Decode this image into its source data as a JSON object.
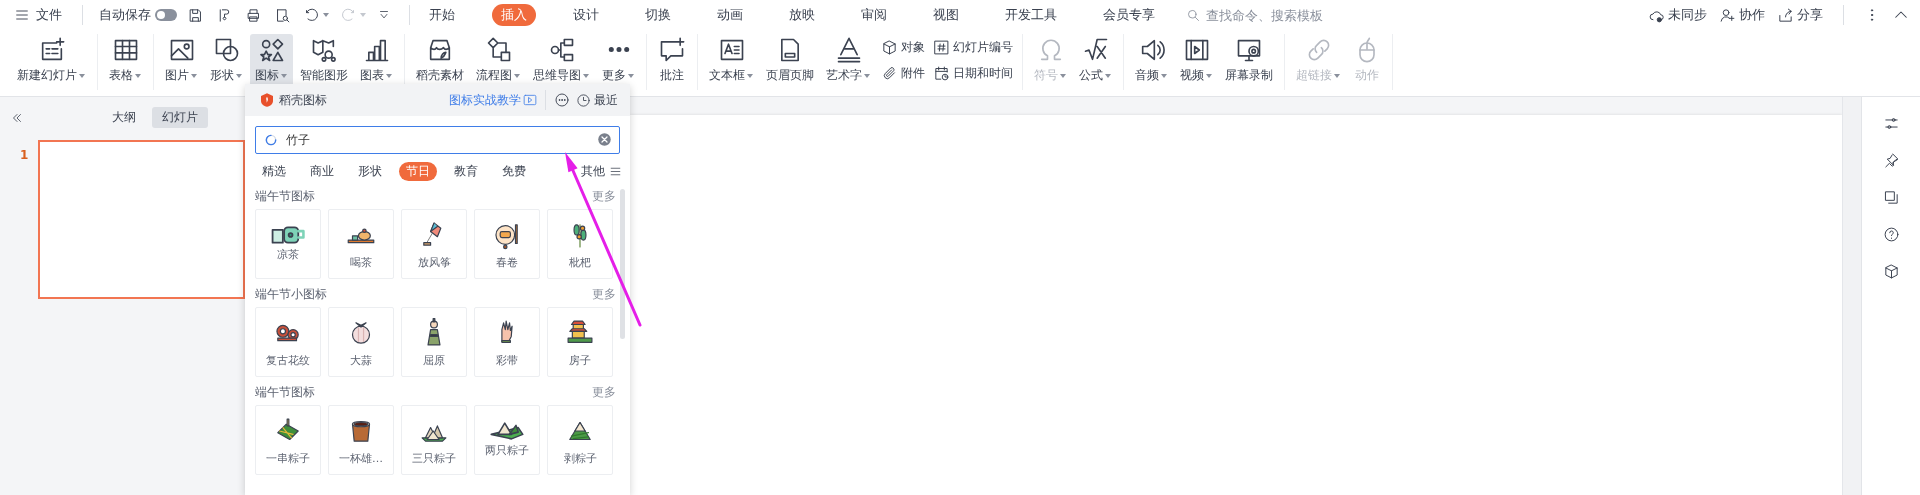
{
  "title_bar": {
    "menu_label": "文件",
    "autosave": {
      "label": "自动保存",
      "on": false
    },
    "tabs": [
      {
        "label": "开始",
        "selected": false
      },
      {
        "label": "插入",
        "selected": true
      },
      {
        "label": "设计",
        "selected": false
      },
      {
        "label": "切换",
        "selected": false
      },
      {
        "label": "动画",
        "selected": false
      },
      {
        "label": "放映",
        "selected": false
      },
      {
        "label": "审阅",
        "selected": false
      },
      {
        "label": "视图",
        "selected": false
      },
      {
        "label": "开发工具",
        "selected": false
      },
      {
        "label": "会员专享",
        "selected": false
      }
    ],
    "search": {
      "placeholder": "查找命令、搜索模板"
    },
    "actions": [
      "未同步",
      "协作",
      "分享"
    ]
  },
  "ribbon": {
    "groups": [
      [
        {
          "kind": "large",
          "label": "新建幻灯片",
          "dropdown": true,
          "selected": false,
          "disabled": false
        }
      ],
      [
        {
          "kind": "large",
          "label": "表格",
          "dropdown": true,
          "selected": false,
          "disabled": false
        }
      ],
      [
        {
          "kind": "large",
          "label": "图片",
          "dropdown": true,
          "selected": false,
          "disabled": false
        },
        {
          "kind": "large",
          "label": "形状",
          "dropdown": true,
          "selected": false,
          "disabled": false
        },
        {
          "kind": "large",
          "label": "图标",
          "dropdown": true,
          "selected": true,
          "disabled": false
        },
        {
          "kind": "large",
          "label": "智能图形",
          "dropdown": false,
          "selected": false,
          "disabled": false
        },
        {
          "kind": "large",
          "label": "图表",
          "dropdown": true,
          "selected": false,
          "disabled": false
        }
      ],
      [
        {
          "kind": "large",
          "label": "稻壳素材",
          "dropdown": false,
          "selected": false,
          "disabled": false
        },
        {
          "kind": "large",
          "label": "流程图",
          "dropdown": true,
          "selected": false,
          "disabled": false
        },
        {
          "kind": "large",
          "label": "思维导图",
          "dropdown": true,
          "selected": false,
          "disabled": false
        },
        {
          "kind": "large",
          "label": "更多",
          "dropdown": true,
          "selected": false,
          "disabled": false
        }
      ],
      [
        {
          "kind": "large",
          "label": "批注",
          "dropdown": false,
          "selected": false,
          "disabled": false
        }
      ],
      [
        {
          "kind": "large",
          "label": "文本框",
          "dropdown": true,
          "selected": false,
          "disabled": false
        },
        {
          "kind": "large",
          "label": "页眉页脚",
          "dropdown": false,
          "selected": false,
          "disabled": false
        },
        {
          "kind": "large",
          "label": "艺术字",
          "dropdown": true,
          "selected": false,
          "disabled": false
        },
        {
          "kind": "small",
          "label": "对象",
          "dropdown": false,
          "selected": false,
          "disabled": false
        },
        {
          "kind": "small",
          "label": "附件",
          "dropdown": false,
          "selected": false,
          "disabled": false
        },
        {
          "kind": "small",
          "label": "幻灯片编号",
          "dropdown": false,
          "selected": false,
          "disabled": false
        },
        {
          "kind": "small",
          "label": "日期和时间",
          "dropdown": false,
          "selected": false,
          "disabled": false
        }
      ],
      [
        {
          "kind": "large",
          "label": "符号",
          "dropdown": true,
          "selected": false,
          "disabled": true
        },
        {
          "kind": "large",
          "label": "公式",
          "dropdown": true,
          "selected": false,
          "disabled": false
        }
      ],
      [
        {
          "kind": "large",
          "label": "音频",
          "dropdown": true,
          "selected": false,
          "disabled": false
        },
        {
          "kind": "large",
          "label": "视频",
          "dropdown": true,
          "selected": false,
          "disabled": false
        },
        {
          "kind": "large",
          "label": "屏幕录制",
          "dropdown": false,
          "selected": false,
          "disabled": false
        }
      ],
      [
        {
          "kind": "large",
          "label": "超链接",
          "dropdown": true,
          "selected": false,
          "disabled": true
        },
        {
          "kind": "large",
          "label": "动作",
          "dropdown": false,
          "selected": false,
          "disabled": true
        }
      ]
    ]
  },
  "side_panel": {
    "tabs": [
      {
        "label": "大纲",
        "selected": false
      },
      {
        "label": "幻灯片",
        "selected": true
      }
    ],
    "slides": [
      {
        "number": "1",
        "selected": true
      }
    ]
  },
  "icon_panel": {
    "title": "稻壳图标",
    "tutorial_link": "图标实战教学",
    "recent_label": "最近",
    "search": {
      "value": "竹子"
    },
    "categories": [
      {
        "label": "精选",
        "selected": false
      },
      {
        "label": "商业",
        "selected": false
      },
      {
        "label": "形状",
        "selected": false
      },
      {
        "label": "节日",
        "selected": true
      },
      {
        "label": "教育",
        "selected": false
      },
      {
        "label": "免费",
        "selected": false
      }
    ],
    "more_categories": "其他",
    "sections": [
      {
        "title": "端午节图标",
        "more": "更多",
        "items": [
          "凉茶",
          "喝茶",
          "放风筝",
          "春卷",
          "枇杷"
        ]
      },
      {
        "title": "端午节小图标",
        "more": "更多",
        "items": [
          "复古花纹",
          "大蒜",
          "屈原",
          "彩带",
          "房子"
        ]
      },
      {
        "title": "端午节图标",
        "more": "更多",
        "items": [
          "一串粽子",
          "一杯雄…",
          "三只粽子",
          "两只粽子",
          "剥粽子"
        ]
      }
    ]
  }
}
